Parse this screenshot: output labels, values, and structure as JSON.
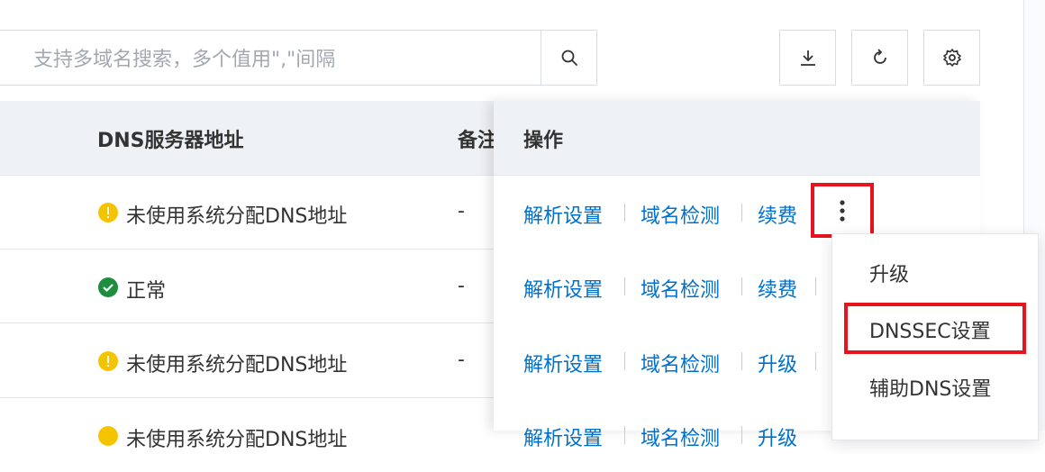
{
  "toolbar": {
    "search_placeholder": "支持多域名搜索，多个值用\",\"间隔",
    "search_icon": "search-icon",
    "download_icon": "download-icon",
    "refresh_icon": "refresh-icon",
    "settings_icon": "gear-icon"
  },
  "table": {
    "columns": {
      "dns": "DNS服务器地址",
      "remark": "备注",
      "ops": "操作"
    },
    "rows": [
      {
        "status": "warning",
        "dns": "未使用系统分配DNS地址",
        "remark": "-",
        "op1": "解析设置",
        "op2": "域名检测",
        "op3": "续费"
      },
      {
        "status": "ok",
        "dns": "正常",
        "remark": "-",
        "op1": "解析设置",
        "op2": "域名检测",
        "op3": "续费"
      },
      {
        "status": "warning",
        "dns": "未使用系统分配DNS地址",
        "remark": "-",
        "op1": "解析设置",
        "op2": "域名检测",
        "op3": "升级"
      },
      {
        "status": "warning",
        "dns": "未使用系统分配DNS地址",
        "remark": "-",
        "op1": "解析设置",
        "op2": "域名检测",
        "op3": "升级"
      }
    ]
  },
  "more_menu": {
    "items": [
      "升级",
      "DNSSEC设置",
      "辅助DNS设置"
    ]
  },
  "colors": {
    "link": "#0070cc",
    "warning": "#f5c400",
    "ok": "#1e8e3e",
    "highlight": "#e5141e",
    "header_bg": "#eef1f5"
  }
}
